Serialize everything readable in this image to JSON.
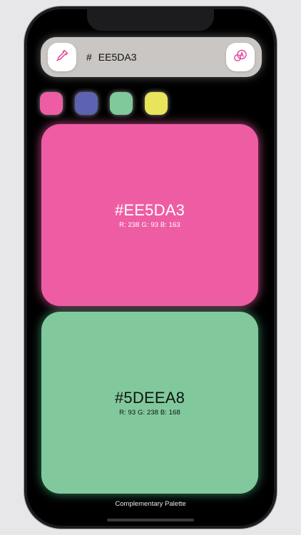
{
  "toolbar": {
    "hash_symbol": "#",
    "hex_value": "EE5DA3",
    "left_icon": "eyedropper-icon",
    "right_icon": "palette-generate-icon"
  },
  "swatches": [
    {
      "color": "#EE5DA3"
    },
    {
      "color": "#5D63B1"
    },
    {
      "color": "#7FC99B"
    },
    {
      "color": "#E8E45C"
    }
  ],
  "cards": {
    "primary": {
      "hex": "#EE5DA3",
      "rgb": "R: 238 G: 93 B: 163",
      "color": "#EE5DA3"
    },
    "secondary": {
      "hex": "#5DEEA8",
      "rgb": "R: 93 G: 238 B: 168",
      "color": "#81C99C"
    }
  },
  "palette": {
    "label": "Complementary Palette"
  },
  "colors": {
    "accent": "#E0449A",
    "toolbar_bg": "#C9C6C3",
    "screen_bg": "#000000"
  }
}
